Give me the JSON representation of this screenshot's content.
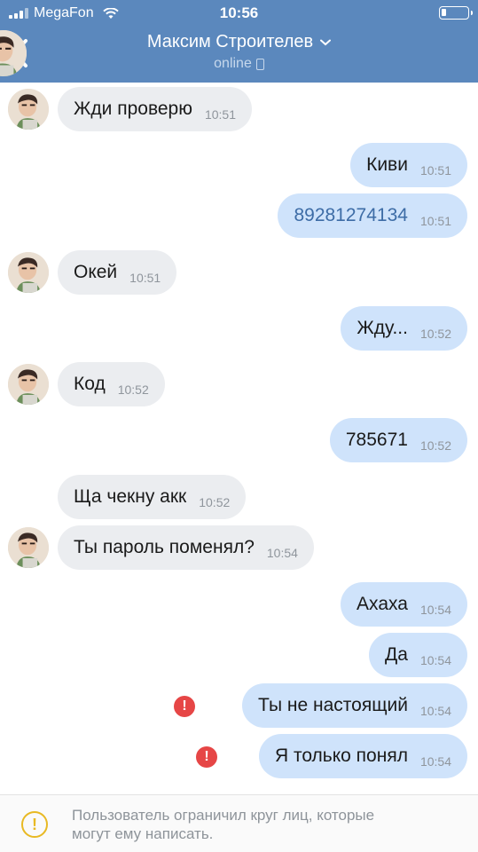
{
  "status_bar": {
    "carrier": "MegaFon",
    "time": "10:56"
  },
  "header": {
    "title": "Максим Строителев",
    "subtitle": "online",
    "accent_color": "#5b88bd"
  },
  "messages": [
    {
      "dir": "in",
      "text": "Жди проверю",
      "time": "10:51",
      "avatar": true,
      "error": false
    },
    {
      "dir": "out",
      "text": "Киви",
      "time": "10:51",
      "avatar": false,
      "error": false
    },
    {
      "dir": "out",
      "text": "89281274134",
      "time": "10:51",
      "avatar": false,
      "error": false,
      "link": true
    },
    {
      "dir": "in",
      "text": "Окей",
      "time": "10:51",
      "avatar": true,
      "error": false
    },
    {
      "dir": "out",
      "text": "Жду...",
      "time": "10:52",
      "avatar": false,
      "error": false
    },
    {
      "dir": "in",
      "text": "Код",
      "time": "10:52",
      "avatar": true,
      "error": false
    },
    {
      "dir": "out",
      "text": "785671",
      "time": "10:52",
      "avatar": false,
      "error": false
    },
    {
      "dir": "in",
      "text": "Ща чекну акк",
      "time": "10:52",
      "avatar": false,
      "error": false
    },
    {
      "dir": "in",
      "text": "Ты пароль поменял?",
      "time": "10:54",
      "avatar": true,
      "error": false
    },
    {
      "dir": "out",
      "text": "Ахаха",
      "time": "10:54",
      "avatar": false,
      "error": false
    },
    {
      "dir": "out",
      "text": "Да",
      "time": "10:54",
      "avatar": false,
      "error": false
    },
    {
      "dir": "out",
      "text": "Ты не настоящий",
      "time": "10:54",
      "avatar": false,
      "error": true
    },
    {
      "dir": "out",
      "text": "Я только понял",
      "time": "10:54",
      "avatar": false,
      "error": true
    }
  ],
  "notice": {
    "text": "Пользователь ограничил круг лиц, которые\nмогут ему написать.",
    "icon": "warning-icon"
  },
  "icons": {
    "back": "chevron-left-icon",
    "title_dropdown": "chevron-down-icon",
    "online_device": "phone-icon",
    "error": "exclamation-icon"
  }
}
